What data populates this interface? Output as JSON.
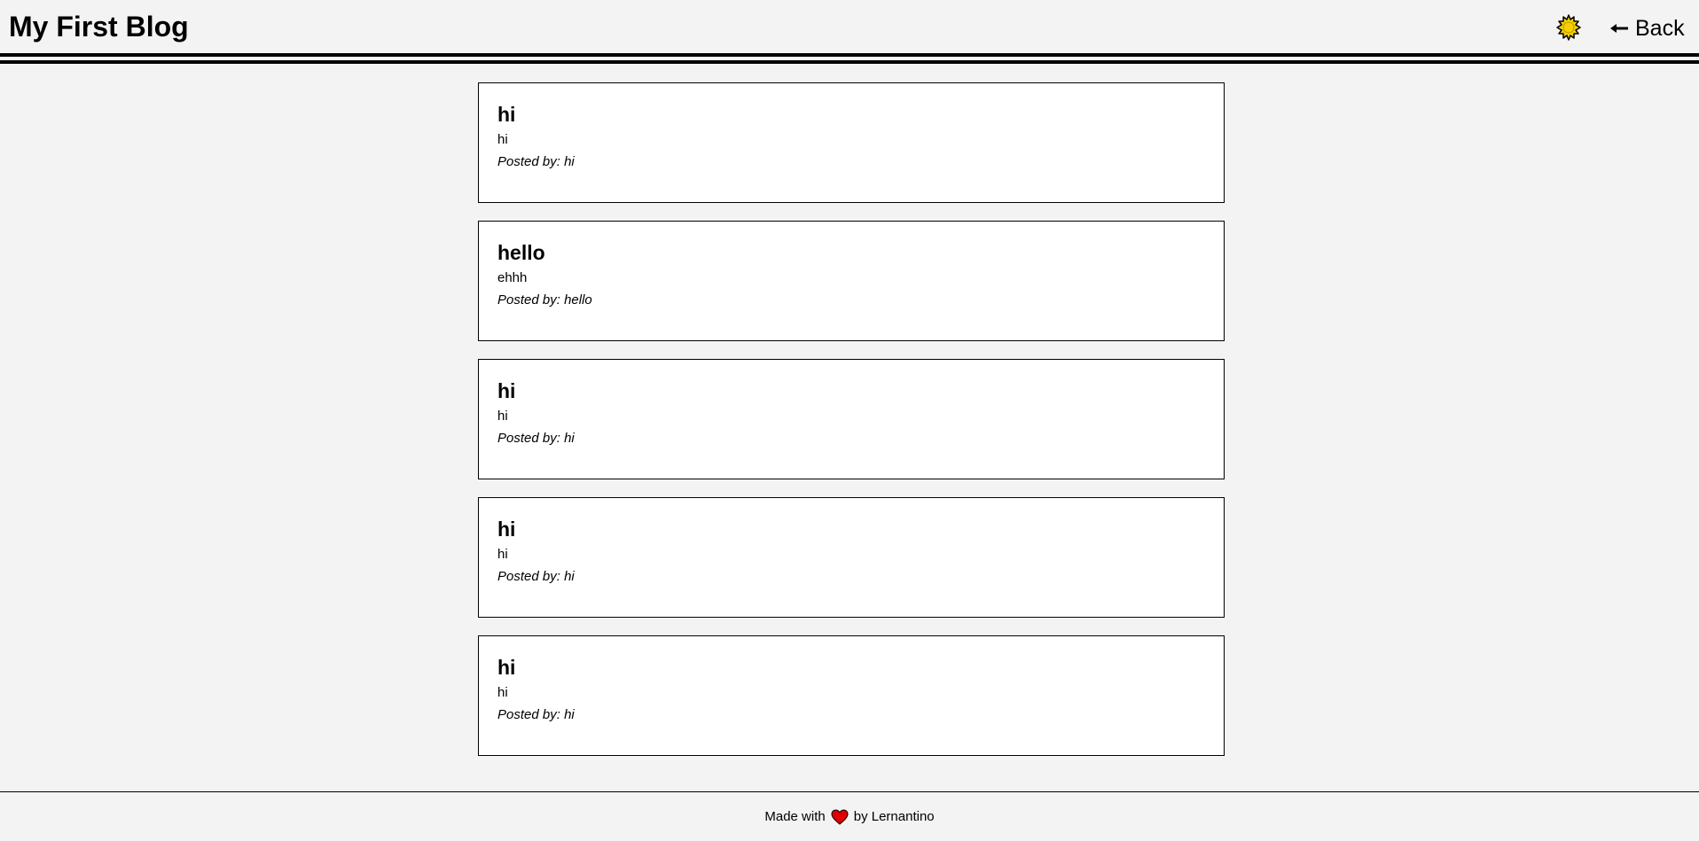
{
  "header": {
    "title": "My First Blog",
    "theme_icon": "sun-icon",
    "back_label": "Back",
    "back_icon": "arrow-left-icon"
  },
  "posts": [
    {
      "title": "hi",
      "body": "hi",
      "author_prefix": "Posted by:",
      "author": "hi"
    },
    {
      "title": "hello",
      "body": "ehhh",
      "author_prefix": "Posted by:",
      "author": "hello"
    },
    {
      "title": "hi",
      "body": "hi",
      "author_prefix": "Posted by:",
      "author": "hi"
    },
    {
      "title": "hi",
      "body": "hi",
      "author_prefix": "Posted by:",
      "author": "hi"
    },
    {
      "title": "hi",
      "body": "hi",
      "author_prefix": "Posted by:",
      "author": "hi"
    }
  ],
  "footer": {
    "made_with": "Made with",
    "heart_icon": "heart-icon",
    "by_text": "by Lernantino"
  },
  "colors": {
    "background": "#f3f3f3",
    "card": "#ffffff",
    "sun": "#f5d000",
    "heart": "#e00000"
  }
}
